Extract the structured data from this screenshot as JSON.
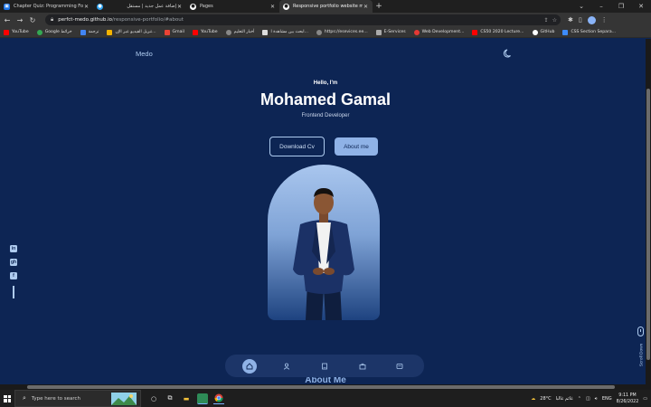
{
  "browser": {
    "tabs": [
      {
        "title": "Chapter Quiz: Programming Fou",
        "icon": "quiz-site-icon",
        "color": "#1a73e8",
        "active": false
      },
      {
        "title": "إضافة عمل جديد | مستقل",
        "icon": "mostaql-icon",
        "color": "#2ea3f2",
        "active": false
      },
      {
        "title": "Pages",
        "icon": "github-icon",
        "color": "#ffffff",
        "active": false
      },
      {
        "title": "Responsive portfolio website mo",
        "icon": "github-icon",
        "color": "#ffffff",
        "active": true
      }
    ],
    "new_tab": "+",
    "window_controls": [
      "⌄",
      "–",
      "❐",
      "✕"
    ],
    "url_host": "perfct-medo.github.io",
    "url_path": "/responsive-portfolio/#about",
    "bookmarks": [
      {
        "label": "YouTube",
        "color": "#ff0000"
      },
      {
        "label": "Google خرائط",
        "color": "#34a853"
      },
      {
        "label": "ترجمة",
        "color": "#4285f4"
      },
      {
        "label": "تنزيل الفيديو عبر الإن...",
        "color": "#f5b400"
      },
      {
        "label": "Gmail",
        "color": "#ea4335"
      },
      {
        "label": "YouTube",
        "color": "#ff0000"
      },
      {
        "label": "أخبار التعليم",
        "color": "#888888"
      },
      {
        "label": "ابحث بين مشاهدة ا...",
        "color": "#dddddd"
      },
      {
        "label": "https://esevices.ee...",
        "color": "#888888"
      },
      {
        "label": "E-Services",
        "color": "#aaaaaa"
      },
      {
        "label": "Web Development...",
        "color": "#e53935"
      },
      {
        "label": "CS50 2020 Lecture...",
        "color": "#ff0000"
      },
      {
        "label": "GitHub",
        "color": "#ffffff"
      },
      {
        "label": "CSS Section Separa...",
        "color": "#3d8bfd"
      }
    ]
  },
  "page": {
    "logo": "Medo",
    "hello": "Hello, I'm",
    "name": "Mohamed Gamal",
    "role": "Frontend Developer",
    "download_cv": "Download Cv",
    "about_me_btn": "About me",
    "section_title": "About Me",
    "scroll_down": "Scroll Down",
    "socials": [
      "in",
      "gh",
      "f"
    ],
    "nav_items": [
      "home",
      "user",
      "book",
      "briefcase",
      "message"
    ]
  },
  "taskbar": {
    "search_placeholder": "Type here to search",
    "temperature": "28°C",
    "weather": "غائم غالبا",
    "language": "ENG",
    "time": "9:11 PM",
    "date": "8/26/2022"
  },
  "colors": {
    "background": "#0d2554",
    "accent": "#8fb2e6",
    "accent_light": "#aecbef"
  }
}
